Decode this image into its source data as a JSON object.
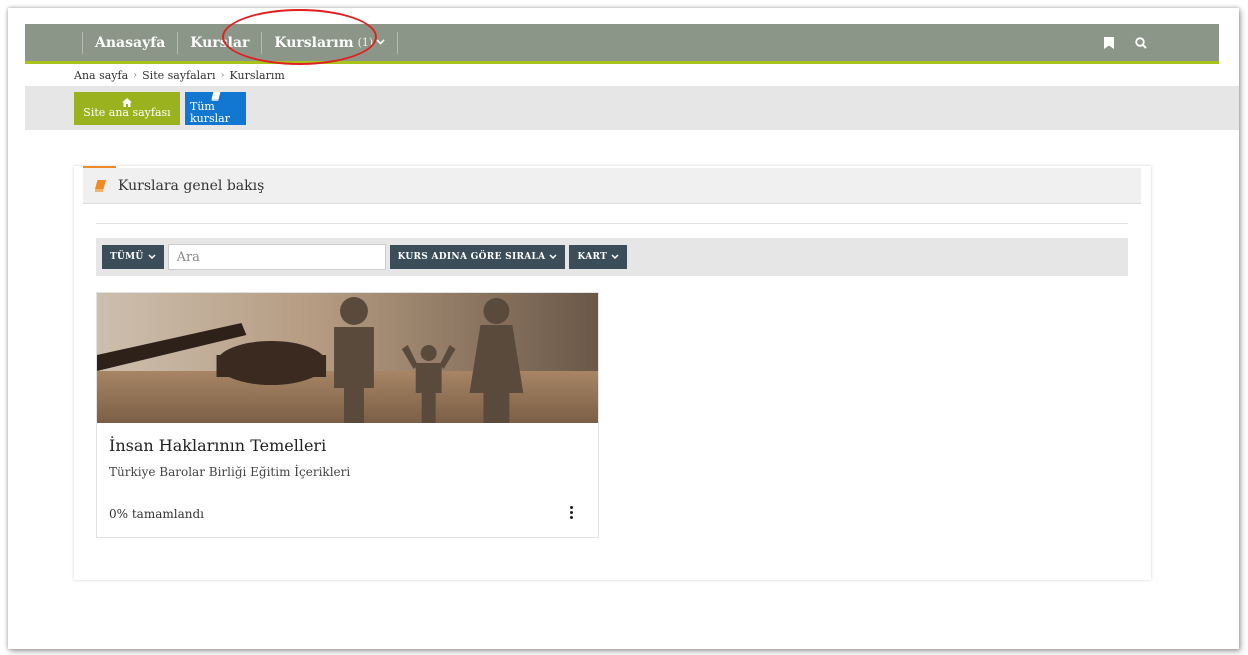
{
  "navbar": {
    "items": [
      {
        "label": "Anasayfa"
      },
      {
        "label": "Kurslar"
      },
      {
        "label": "Kurslarım",
        "count": "(1)"
      }
    ]
  },
  "breadcrumb": [
    "Ana sayfa",
    "Site sayfaları",
    "Kurslarım"
  ],
  "quick_buttons": [
    {
      "label": "Site ana sayfası",
      "icon": "home-icon",
      "color": "#9ab21d"
    },
    {
      "label": "Tüm kurslar",
      "icon": "book-icon",
      "color": "#1177d1"
    }
  ],
  "panel": {
    "title": "Kurslara genel bakış",
    "filter_label": "TÜMÜ",
    "search_placeholder": "Ara",
    "sort_label": "KURS ADINA GÖRE SIRALA",
    "view_label": "KART"
  },
  "course": {
    "title": "İnsan Haklarının Temelleri",
    "category": "Türkiye Barolar Birliği Eğitim İçerikleri",
    "progress_text": "0% tamamlandı",
    "progress": 0
  },
  "colors": {
    "navbar": "#8c9688",
    "accent_green": "#a8c31c",
    "button_green": "#9ab21d",
    "button_blue": "#1177d1",
    "filter_button": "#3c4d5a",
    "panel_accent": "#f08a24",
    "annotation": "#e02020"
  }
}
